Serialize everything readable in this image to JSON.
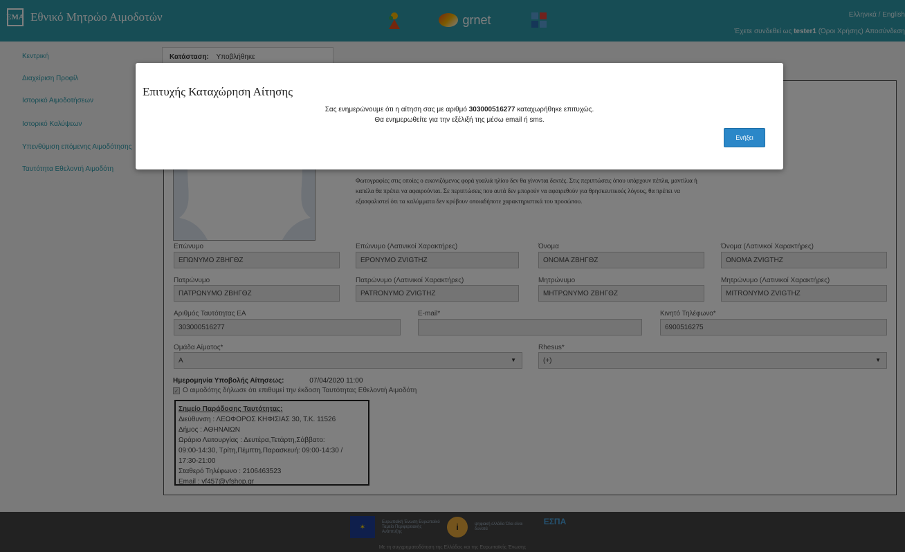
{
  "header": {
    "logo_text": "ΕΜΑ",
    "title": "Εθνικό Μητρώο Αιμοδοτών",
    "partner_logo": "grnet",
    "lang": "Ελληνικά / English",
    "user_prefix": "Έχετε συνδεθεί ως",
    "username": "tester1",
    "terms": "(Όροι Χρήσης)",
    "logout": "Αποσύνδεση"
  },
  "sidebar": {
    "items": [
      {
        "label": "Κεντρική"
      },
      {
        "label": "Διαχείριση Προφίλ"
      },
      {
        "label": "Ιστορικό Αιμοδοτήσεων"
      },
      {
        "label": "Ιστορικό Καλύψεων"
      },
      {
        "label": "Υπενθύμιση επόμενης Αιμοδότησης"
      },
      {
        "label": "Ταυτότητα Εθελοντή Αιμοδότη"
      }
    ]
  },
  "status": {
    "label": "Κατάσταση:",
    "value": "Υποβλήθηκε"
  },
  "photo_note": "Φωτογραφίες στις οποίες ο εικονιζόμενος φορά γυαλιά ηλίου δεν θα γίνονται δεκτές. Στις περιπτώσεις όπου υπάρχουν πέπλα, μαντίλια ή καπέλα θα πρέπει να αφαιρούνται. Σε περιπτώσεις που αυτά δεν μπορούν να αφαιρεθούν για θρησκευτικούς λόγους, θα πρέπει να εξασφαλιστεί ότι τα καλύμματα δεν κρύβουν οποιαδήποτε χαρακτηριστικά του προσώπου.",
  "form": {
    "surname_label": "Επώνυμο",
    "surname": "ΕΠΩΝΥΜΟ ΖΒΗΓΘΖ",
    "surname_latin_label": "Επώνυμο (Λατινικοί Χαρακτήρες)",
    "surname_latin": "EPONYMO ZVIGTHZ",
    "name_label": "Όνομα",
    "name": "ΟΝΟΜΑ ΖΒΗΓΘΖ",
    "name_latin_label": "Όνομα (Λατινικοί Χαρακτήρες)",
    "name_latin": "ONOMA ZVIGTHZ",
    "father_label": "Πατρώνυμο",
    "father": "ΠΑΤΡΩΝΥΜΟ ΖΒΗΓΘΖ",
    "father_latin_label": "Πατρώνυμο (Λατινικοί Χαρακτήρες)",
    "father_latin": "PATRONYMO ZVIGTHZ",
    "mother_label": "Μητρώνυμο",
    "mother": "ΜΗΤΡΩΝΥΜΟ ΖΒΗΓΘΖ",
    "mother_latin_label": "Μητρώνυμο (Λατινικοί Χαρακτήρες)",
    "mother_latin": "MITRONYMO ZVIGTHZ",
    "id_label": "Αριθμός Ταυτότητας ΕΑ",
    "id": "303000516277",
    "email_label": "E-mail*",
    "email": "",
    "mobile_label": "Κινητό Τηλέφωνο*",
    "mobile": "6900516275",
    "blood_group_label": "Ομάδα Αίματος*",
    "blood_group": "A",
    "rhesus_label": "Rhesus*",
    "rhesus": "(+)"
  },
  "submission": {
    "label": "Ημερομηνία Υποβολής Αίτησεως:",
    "date": "07/04/2020 11:00",
    "consent": "Ο αιμοδότης δήλωσε ότι επιθυμεί την έκδοση Ταυτότητας Εθελοντή Αιμοδότη"
  },
  "delivery": {
    "title": "Σημείο Παράδοσης Ταυτότητας:",
    "address": "Διεύθυνση : ΛΕΩΦΟΡΟΣ ΚΗΦΙΣΙΑΣ 30, Τ.Κ. 11526",
    "municipality": "Δήμος : ΑΘΗΝΑΙΩΝ",
    "hours_1": "Ωράριο Λειτουργίας : Δευτέρα,Τετάρτη,Σάββατο:",
    "hours_2": "09:00-14:30, Τρίτη,Πέμπτη,Παρασκευή: 09:00-14:30 /",
    "hours_3": "17:30-21:00",
    "phone": "Σταθερό Τηλέφωνο : 2106463523",
    "email": "Email : vf457@vfshop.gr"
  },
  "modal": {
    "title": "Επιτυχής Καταχώρηση Αίτησης",
    "msg_prefix": "Σας ενημερώνουμε ότι η αίτηση σας με αριθμό",
    "msg_number": "303000516277",
    "msg_suffix": "καταχωρήθηκε επιτυχώς.",
    "msg_line2": "Θα ενημερωθείτε για την εξέλιξή της μέσω email ή sms.",
    "button": "Ενήξει"
  },
  "footer": {
    "eu_text": "Ευρωπαϊκή Ένωση Ευρωπαϊκό Ταμείο Περιφερειακής Ανάπτυξης",
    "digital_text": "ψηφιακή ελλάδα Όλα είναι δυνατά",
    "espa": "ΕΣΠΑ",
    "caption": "Με τη συγχρηματοδότηση της Ελλάδας και της Ευρωπαϊκής Ένωσης"
  },
  "colors": {
    "header": "#2f9bab",
    "link": "#2f9bab",
    "button": "#2b87c8",
    "footer": "#444444"
  }
}
